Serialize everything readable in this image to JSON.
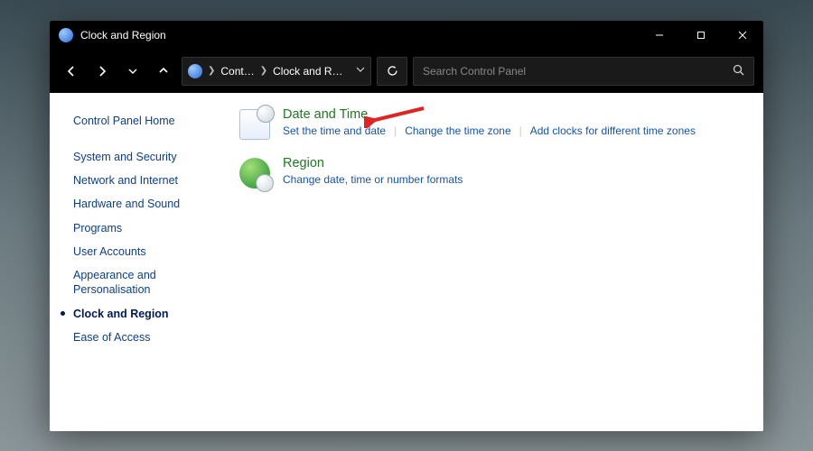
{
  "window": {
    "title": "Clock and Region"
  },
  "addressbar": {
    "crumb1": "Cont…",
    "crumb2": "Clock and R…"
  },
  "search": {
    "placeholder": "Search Control Panel"
  },
  "sidebar": {
    "home": "Control Panel Home",
    "items": [
      "System and Security",
      "Network and Internet",
      "Hardware and Sound",
      "Programs",
      "User Accounts",
      "Appearance and Personalisation",
      "Clock and Region",
      "Ease of Access"
    ],
    "current_index": 6
  },
  "sections": [
    {
      "heading": "Date and Time",
      "links": [
        "Set the time and date",
        "Change the time zone",
        "Add clocks for different time zones"
      ]
    },
    {
      "heading": "Region",
      "links": [
        "Change date, time or number formats"
      ]
    }
  ],
  "annotation": {
    "color": "#e02424"
  }
}
